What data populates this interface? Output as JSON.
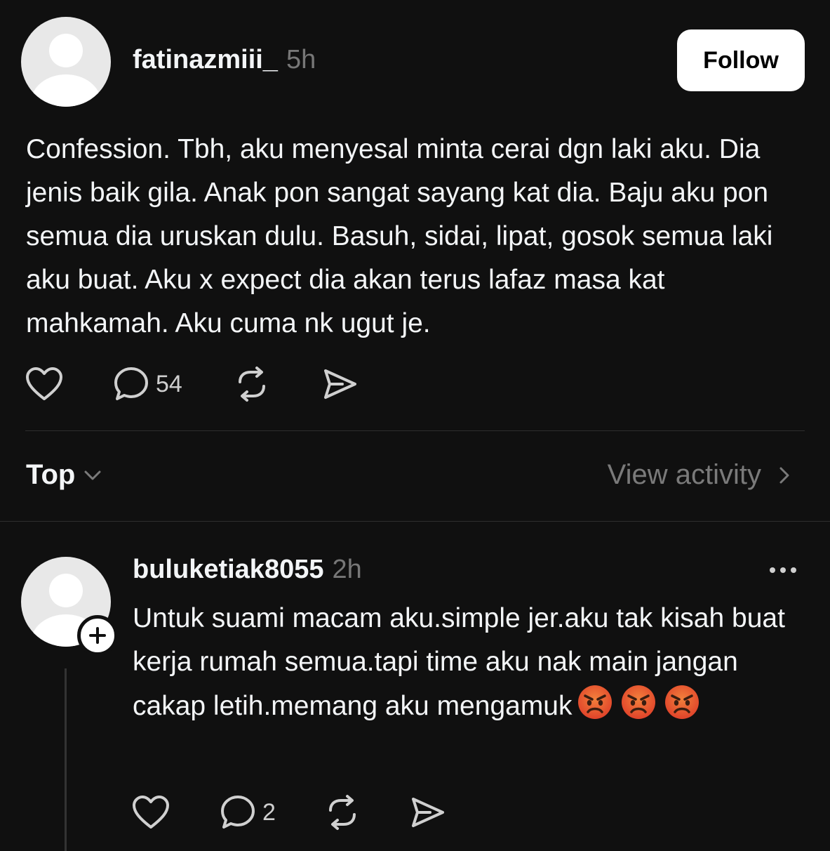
{
  "post": {
    "username": "fatinazmiii_",
    "time": "5h",
    "follow_label": "Follow",
    "text": "Confession. Tbh, aku menyesal minta cerai dgn laki aku. Dia jenis baik gila. Anak pon sangat sayang kat dia. Baju aku pon semua dia uruskan dulu. Basuh, sidai, lipat, gosok semua laki aku buat. Aku x expect dia akan terus lafaz masa kat mahkamah. Aku cuma nk ugut je.",
    "comment_count": "54"
  },
  "sort": {
    "label": "Top",
    "view_activity_label": "View activity"
  },
  "reply": {
    "username": "buluketiak8055",
    "time": "2h",
    "text": "Untuk suami macam aku.simple jer.aku tak kisah buat kerja rumah semua.tapi time aku nak main jangan cakap letih.memang aku mengamuk",
    "comment_count": "2",
    "emojis": [
      "angry-face",
      "angry-face",
      "angry-face"
    ]
  },
  "icons": {
    "like": "heart-icon",
    "comment": "comment-bubble-icon",
    "repost": "repost-icon",
    "share": "send-icon",
    "sort": "chevron-down-icon",
    "view_activity": "chevron-right-icon",
    "more": "more-horizontal-icon",
    "follow_plus": "plus-icon"
  },
  "colors": {
    "background": "#101010",
    "text": "#f3f5f7",
    "muted": "#777777",
    "button_bg": "#ffffff",
    "emoji_red": "#e8542b"
  }
}
